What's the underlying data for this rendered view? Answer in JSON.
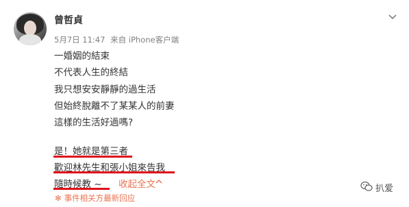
{
  "post": {
    "author": "曾哲貞",
    "date": "5月7日 11:47",
    "source": "来自 iPhone客户端",
    "lines": [
      "一婚姻的結束",
      "不代表人生的終結",
      "我只想安安靜靜的過生活",
      "但始終脫離不了某某人的前妻",
      "這樣的生活好過嗎?",
      "",
      "是！她就是第三者",
      "歡迎林先生和張小姐來告我",
      "隨時候教 ~"
    ],
    "collapse_label": "收起全文",
    "updated_notice": "事件相关方最新回应"
  },
  "watermark": {
    "text": "扒爱"
  },
  "colors": {
    "highlight_underline": "#e0101a",
    "link": "#eb7350"
  },
  "icons": {
    "menu": "chevron-down-icon",
    "collapse": "caret-up-icon",
    "notice": "star-burst-icon",
    "watermark": "wechat-icon"
  }
}
